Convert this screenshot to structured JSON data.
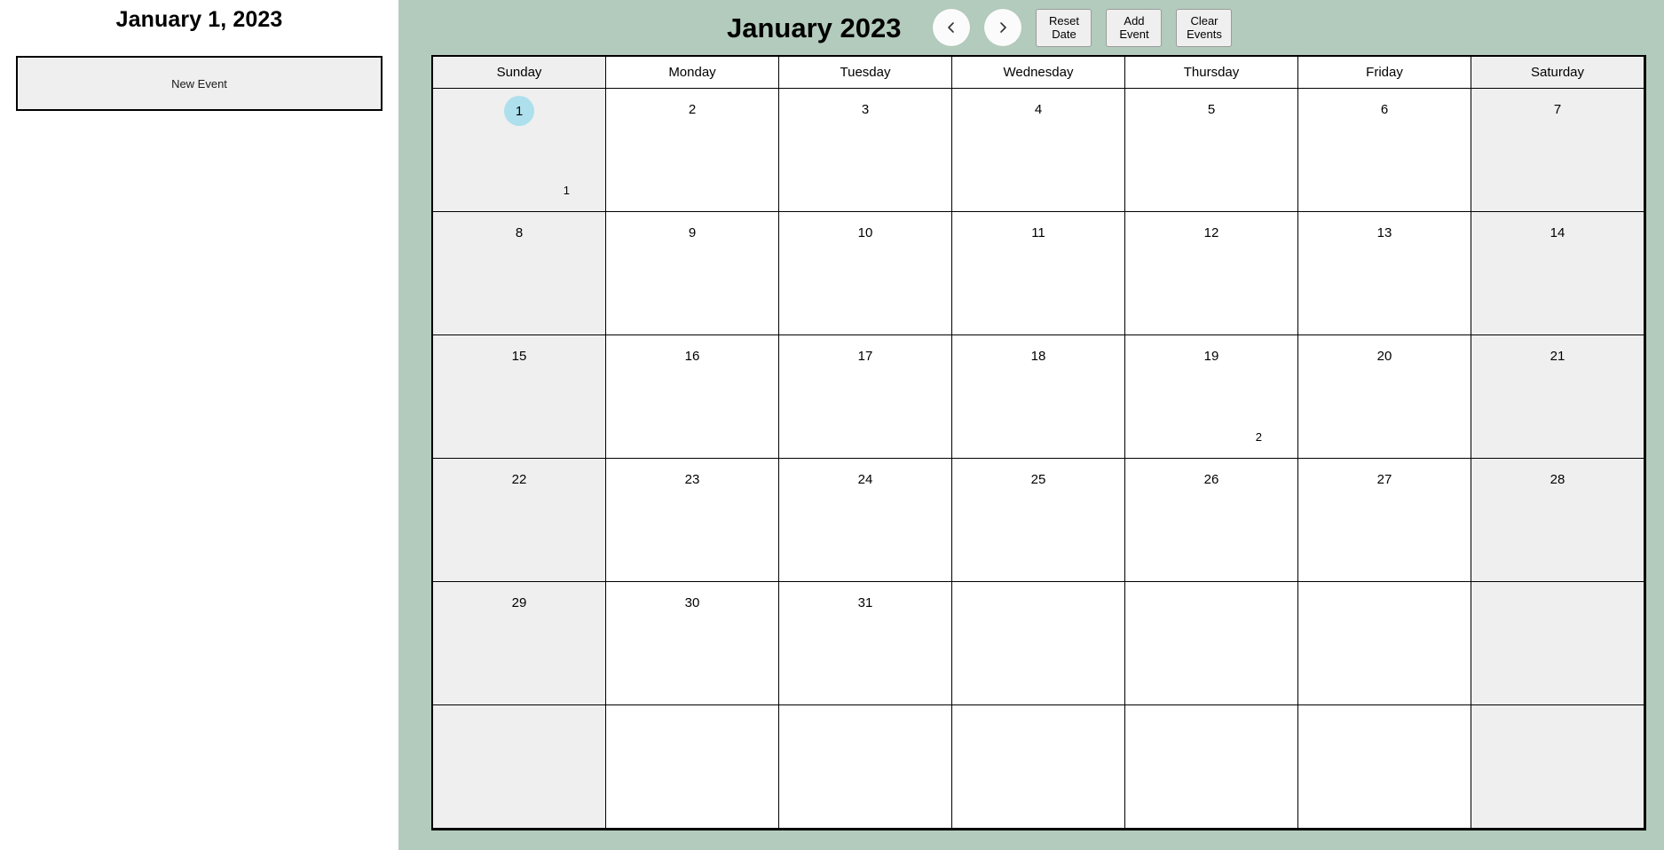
{
  "sidebar": {
    "selected_date_title": "January 1, 2023",
    "events": [
      {
        "label": "New Event"
      }
    ]
  },
  "header": {
    "title": "January 2023",
    "prev_icon": "chevron-left-icon",
    "prev_label": "‹",
    "next_icon": "chevron-right-icon",
    "next_label": "›",
    "buttons": [
      {
        "name": "reset-date-button",
        "label": "Reset\nDate"
      },
      {
        "name": "add-event-button",
        "label": "Add\nEvent"
      },
      {
        "name": "clear-events-button",
        "label": "Clear\nEvents"
      }
    ]
  },
  "calendar": {
    "weekdays": [
      {
        "label": "Sunday",
        "weekend": true
      },
      {
        "label": "Monday",
        "weekend": false
      },
      {
        "label": "Tuesday",
        "weekend": false
      },
      {
        "label": "Wednesday",
        "weekend": false
      },
      {
        "label": "Thursday",
        "weekend": false
      },
      {
        "label": "Friday",
        "weekend": false
      },
      {
        "label": "Saturday",
        "weekend": true
      }
    ],
    "weeks": [
      [
        {
          "day": "1",
          "weekend": true,
          "selected": true,
          "badge": "1"
        },
        {
          "day": "2",
          "weekend": false,
          "selected": false,
          "badge": ""
        },
        {
          "day": "3",
          "weekend": false,
          "selected": false,
          "badge": ""
        },
        {
          "day": "4",
          "weekend": false,
          "selected": false,
          "badge": ""
        },
        {
          "day": "5",
          "weekend": false,
          "selected": false,
          "badge": ""
        },
        {
          "day": "6",
          "weekend": false,
          "selected": false,
          "badge": ""
        },
        {
          "day": "7",
          "weekend": true,
          "selected": false,
          "badge": ""
        }
      ],
      [
        {
          "day": "8",
          "weekend": true,
          "selected": false,
          "badge": ""
        },
        {
          "day": "9",
          "weekend": false,
          "selected": false,
          "badge": ""
        },
        {
          "day": "10",
          "weekend": false,
          "selected": false,
          "badge": ""
        },
        {
          "day": "11",
          "weekend": false,
          "selected": false,
          "badge": ""
        },
        {
          "day": "12",
          "weekend": false,
          "selected": false,
          "badge": ""
        },
        {
          "day": "13",
          "weekend": false,
          "selected": false,
          "badge": ""
        },
        {
          "day": "14",
          "weekend": true,
          "selected": false,
          "badge": ""
        }
      ],
      [
        {
          "day": "15",
          "weekend": true,
          "selected": false,
          "badge": ""
        },
        {
          "day": "16",
          "weekend": false,
          "selected": false,
          "badge": ""
        },
        {
          "day": "17",
          "weekend": false,
          "selected": false,
          "badge": ""
        },
        {
          "day": "18",
          "weekend": false,
          "selected": false,
          "badge": ""
        },
        {
          "day": "19",
          "weekend": false,
          "selected": false,
          "badge": "2"
        },
        {
          "day": "20",
          "weekend": false,
          "selected": false,
          "badge": ""
        },
        {
          "day": "21",
          "weekend": true,
          "selected": false,
          "badge": ""
        }
      ],
      [
        {
          "day": "22",
          "weekend": true,
          "selected": false,
          "badge": ""
        },
        {
          "day": "23",
          "weekend": false,
          "selected": false,
          "badge": ""
        },
        {
          "day": "24",
          "weekend": false,
          "selected": false,
          "badge": ""
        },
        {
          "day": "25",
          "weekend": false,
          "selected": false,
          "badge": ""
        },
        {
          "day": "26",
          "weekend": false,
          "selected": false,
          "badge": ""
        },
        {
          "day": "27",
          "weekend": false,
          "selected": false,
          "badge": ""
        },
        {
          "day": "28",
          "weekend": true,
          "selected": false,
          "badge": ""
        }
      ],
      [
        {
          "day": "29",
          "weekend": true,
          "selected": false,
          "badge": ""
        },
        {
          "day": "30",
          "weekend": false,
          "selected": false,
          "badge": ""
        },
        {
          "day": "31",
          "weekend": false,
          "selected": false,
          "badge": ""
        },
        {
          "day": "",
          "weekend": false,
          "selected": false,
          "badge": ""
        },
        {
          "day": "",
          "weekend": false,
          "selected": false,
          "badge": ""
        },
        {
          "day": "",
          "weekend": false,
          "selected": false,
          "badge": ""
        },
        {
          "day": "",
          "weekend": true,
          "selected": false,
          "badge": ""
        }
      ],
      [
        {
          "day": "",
          "weekend": true,
          "selected": false,
          "badge": ""
        },
        {
          "day": "",
          "weekend": false,
          "selected": false,
          "badge": ""
        },
        {
          "day": "",
          "weekend": false,
          "selected": false,
          "badge": ""
        },
        {
          "day": "",
          "weekend": false,
          "selected": false,
          "badge": ""
        },
        {
          "day": "",
          "weekend": false,
          "selected": false,
          "badge": ""
        },
        {
          "day": "",
          "weekend": false,
          "selected": false,
          "badge": ""
        },
        {
          "day": "",
          "weekend": true,
          "selected": false,
          "badge": ""
        }
      ]
    ]
  },
  "colors": {
    "panel_background": "#b3cbbc",
    "weekend_cell": "#efefef",
    "selected_day": "#ade0ec",
    "grid_line": "#000000",
    "button_face": "#efefef"
  }
}
